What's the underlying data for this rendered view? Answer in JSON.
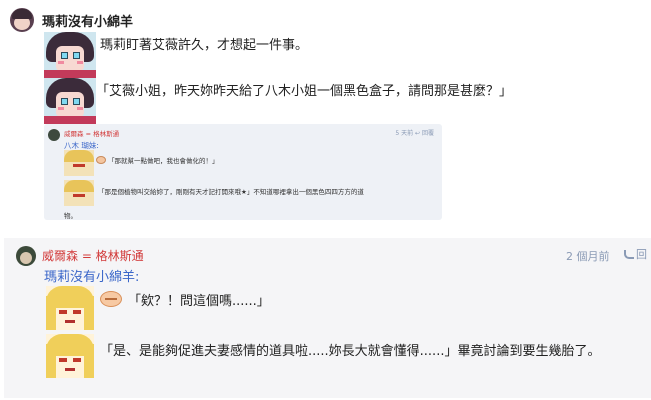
{
  "post1": {
    "author": "瑪莉沒有小綿羊",
    "lines": [
      "瑪莉盯著艾薇許久，才想起一件事。",
      "「艾薇小姐，昨天妳昨天給了八木小姐一個黑色盒子，請問那是甚麼？」"
    ],
    "quote": {
      "author": "威爾森 = 格林斯通",
      "meta": "5 天前   ↩ 回覆",
      "to": "八木 瑚妹:",
      "lines": [
        "「那就幫一點做吧，我也會做化的！」",
        "「那是個植物叫交給妳了，剛剛有天才記打開來哦★」不知道哪裡拿出一個黑色四四方方的道",
        "物。"
      ]
    }
  },
  "post2": {
    "author": "威爾森 = 格林斯通",
    "time": "2 個月前",
    "reply_label": "回",
    "to": "瑪莉沒有小綿羊:",
    "lines": [
      "「欸？！問這個嗎......」",
      "「是、是能夠促進夫妻感情的道具啦.....妳長大就會懂得......」畢竟討論到要生幾胎了。"
    ]
  },
  "icons": {
    "reply": "reply-icon",
    "avatar": "avatar"
  },
  "colors": {
    "author_red": "#d23a3a",
    "mention_blue": "#3a66c9",
    "meta_gray": "#8a9ab5",
    "quote_bg": "#eef1f6",
    "post2_bg": "#f5f5f7"
  }
}
